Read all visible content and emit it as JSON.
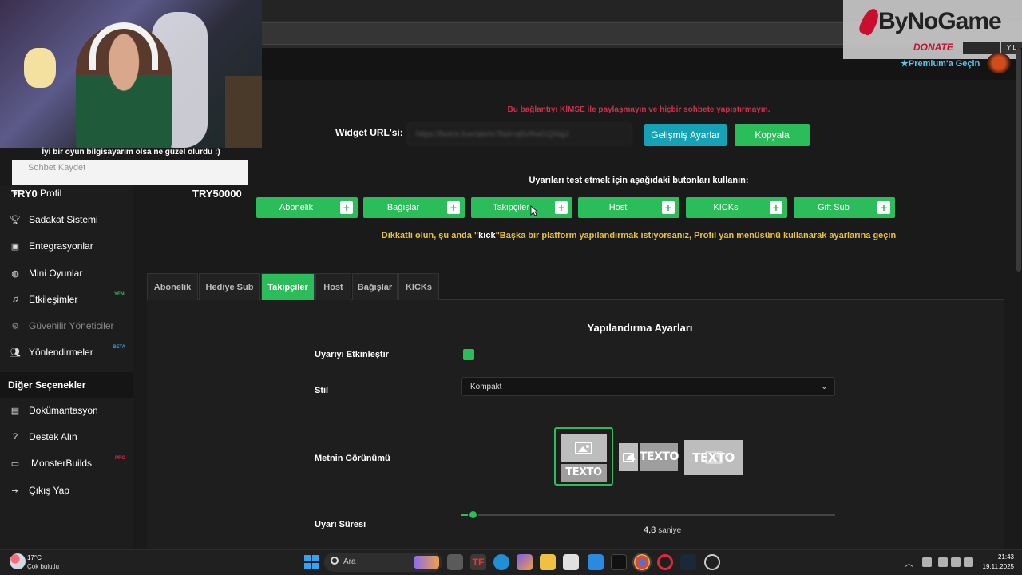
{
  "overlay": {
    "cam_caption": "İyi bir oyun bilgisayarım olsa ne güzel olurdu :)",
    "chat_placeholder": "Sohbet Kaydet",
    "try_left": "TRY0",
    "try_right": "TRY50000",
    "bunogame_logo": "ByNoGame",
    "donate": "DONATE",
    "yil": "YIL",
    "premium": "Premium'a Geçin"
  },
  "sidebar": {
    "partial_item": "Profil",
    "items": [
      {
        "label": "Sadakat Sistemi",
        "icon": "trophy-icon"
      },
      {
        "label": "Entegrasyonlar",
        "icon": "integrations-icon"
      },
      {
        "label": "Mini Oyunlar",
        "icon": "gamepad-icon"
      },
      {
        "label": "Etkileşimler",
        "icon": "music-note-icon",
        "badge": "YENİ"
      },
      {
        "label": "Güvenilir Yöneticiler",
        "icon": "shield-user-icon"
      },
      {
        "label": "Yönlendirmeler",
        "icon": "users-icon",
        "badge": "BETA"
      }
    ],
    "section_title": "Diğer Seçenekler",
    "other_items": [
      {
        "label": "Dokümantasyon",
        "icon": "document-icon"
      },
      {
        "label": "Destek Alın",
        "icon": "help-icon"
      },
      {
        "label": "MonsterBuilds",
        "icon": "monitor-icon",
        "badge": "PRO"
      },
      {
        "label": "Çıkış Yap",
        "icon": "logout-icon"
      }
    ]
  },
  "main": {
    "warning": "Bu bağlantıyı KİMSE ile paylaşmayın ve hiçbir sohbete yapıştırmayın.",
    "widget_label": "Widget URL'si:",
    "widget_url": "https://botrix.live/alerts?bid=qthrRwl1QNqjJ",
    "advanced_button": "Gelişmiş Ayarlar",
    "copy_button": "Kopyala",
    "test_info": "Uyarıları test etmek için aşağıdaki butonları kullanın:",
    "test_buttons": [
      "Abonelik",
      "Bağışlar",
      "Takipçiler",
      "Host",
      "KICKs",
      "Gift Sub"
    ],
    "notice_pre": "Dikkatli olun, şu anda \"",
    "notice_kw": "kick",
    "notice_post": "\"Başka bir platform yapılandırmak istiyorsanız, Profil yan menüsünü kullanarak ayarlarına geçin"
  },
  "tabs": [
    "Abonelik",
    "Hediye Sub",
    "Takipçiler",
    "Host",
    "Bağışlar",
    "KICKs"
  ],
  "active_tab": "Takipçiler",
  "config": {
    "title": "Yapılandırma Ayarları",
    "enable_label": "Uyarıyı Etkinleştir",
    "enable_value": true,
    "style_label": "Stil",
    "style_value": "Kompakt",
    "text_look_label": "Metnin Görünümü",
    "thumb_text": "TEXTO",
    "duration_label": "Uyarı Süresi",
    "duration_value": "4,8",
    "duration_unit": "saniye",
    "duration_fraction": 0.03
  },
  "taskbar": {
    "temp": "17°C",
    "weather": "Çok bulutlu",
    "search_placeholder": "Ara",
    "time": "21:43",
    "date": "19.11.2025"
  },
  "colors": {
    "accent": "#2bbd5a",
    "teal": "#15a1b6",
    "warning": "#d0304a",
    "notice": "#e6c13a"
  }
}
